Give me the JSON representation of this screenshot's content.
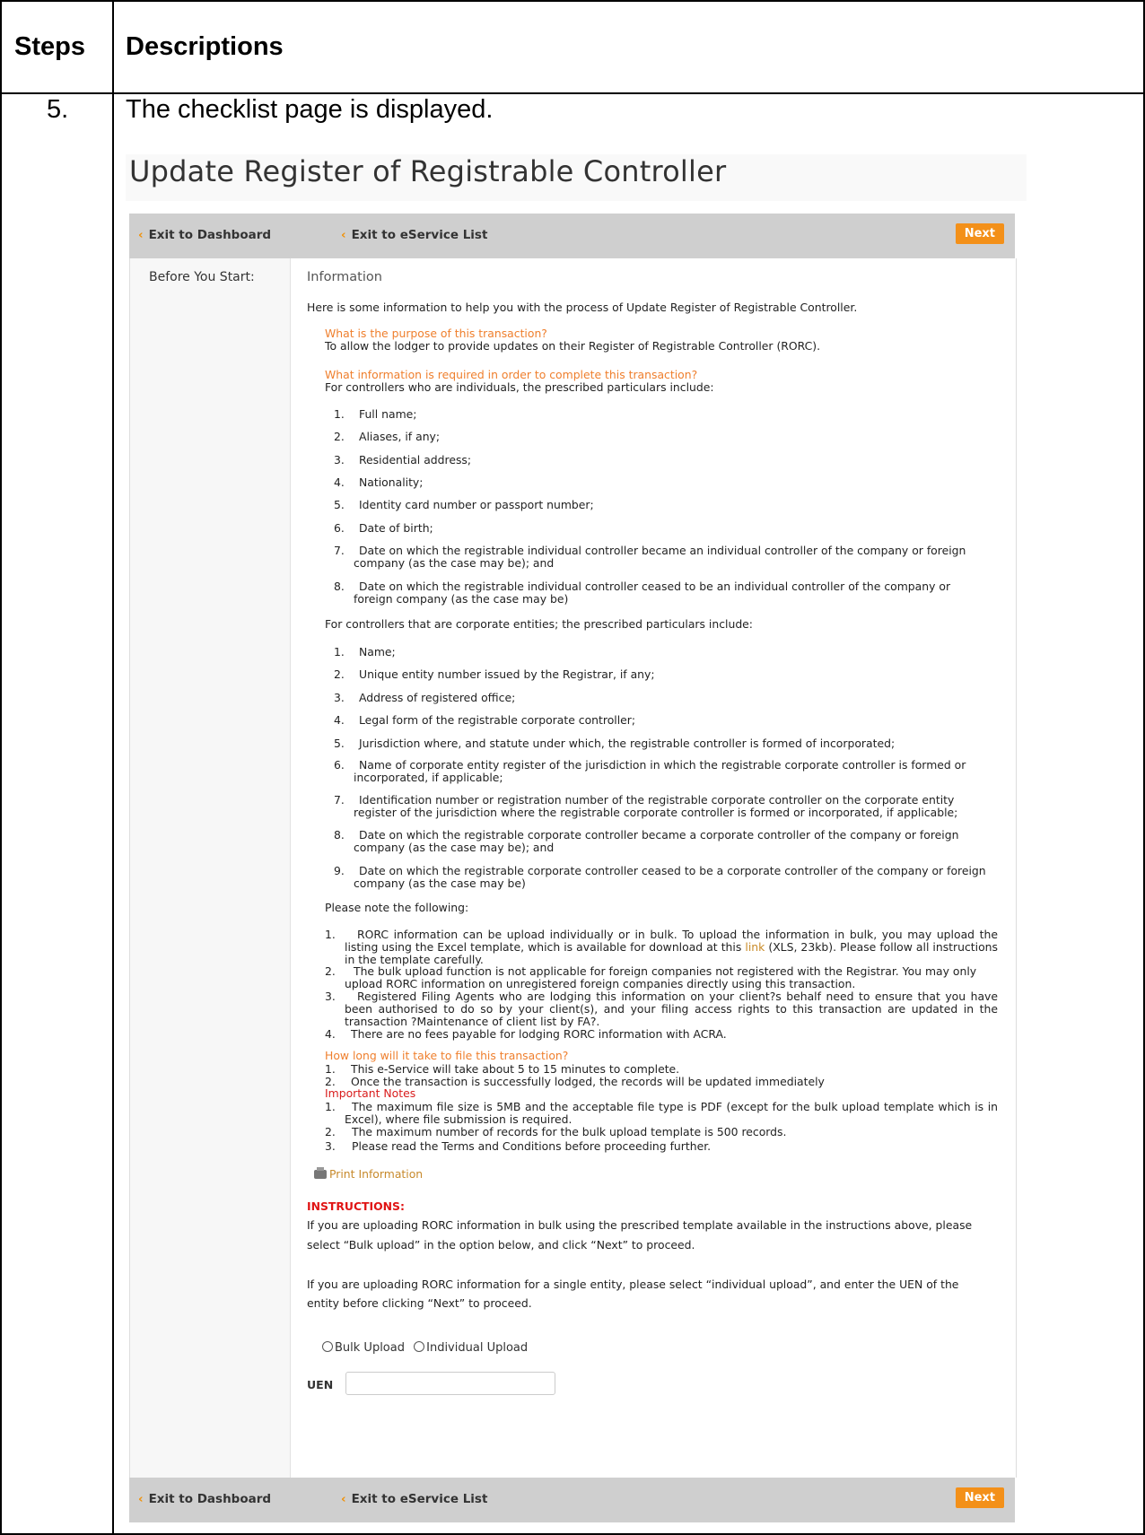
{
  "table": {
    "col_steps": "Steps",
    "col_descriptions": "Descriptions",
    "step_number": "5.",
    "step_text": "The checklist page is displayed."
  },
  "screen": {
    "title": "Update Register of Registrable Controller",
    "nav": {
      "exit_dashboard": "Exit to Dashboard",
      "exit_eservice": "Exit to eService List",
      "next": "Next"
    },
    "left_label": "Before You Start:",
    "info_heading": "Information",
    "intro": "Here is some information to help you with the process of Update Register of Registrable Controller.",
    "q1": "What is the purpose of this transaction?",
    "a1": "To allow the lodger to provide updates on their Register of Registrable Controller (RORC).",
    "q2": "What information is required in order to complete this transaction?",
    "individuals_intro": "For controllers who are individuals, the prescribed particulars include:",
    "individuals": [
      {
        "n": "1.",
        "t": "Full name;"
      },
      {
        "n": "2.",
        "t": "Aliases, if any;"
      },
      {
        "n": "3.",
        "t": "Residential address;"
      },
      {
        "n": "4.",
        "t": "Nationality;"
      },
      {
        "n": "5.",
        "t": "Identity card number or passport number;"
      },
      {
        "n": "6.",
        "t": "Date of birth;"
      },
      {
        "n": "7.",
        "t": "Date on which the registrable individual controller became an individual controller of the company or foreign",
        "t2": "company (as the case may be); and"
      },
      {
        "n": "8.",
        "t": "Date on which the registrable individual controller ceased to be an individual controller of the company or",
        "t2": "foreign company (as the case may be)"
      }
    ],
    "corporate_intro": "For controllers that are corporate entities; the prescribed particulars include:",
    "corporate": [
      {
        "n": "1.",
        "t": "Name;"
      },
      {
        "n": "2.",
        "t": "Unique entity number issued by the Registrar, if any;"
      },
      {
        "n": "3.",
        "t": "Address of registered office;"
      },
      {
        "n": "4.",
        "t": "Legal form of the registrable corporate controller;"
      },
      {
        "n": "5.",
        "t": "Jurisdiction where, and statute under which, the registrable controller is formed of incorporated;"
      },
      {
        "n": "6.",
        "t": "Name of corporate entity register of the jurisdiction in which the registrable corporate controller is formed or",
        "t2": "incorporated, if applicable;"
      },
      {
        "n": "7.",
        "t": "Identification number or registration number of the registrable corporate controller on the corporate entity",
        "t2": "register of the jurisdiction where the registrable corporate controller is formed or incorporated, if applicable;"
      },
      {
        "n": "8.",
        "t": "Date on which the registrable corporate controller became a corporate controller of the company or foreign",
        "t2": "company (as the case may be); and"
      },
      {
        "n": "9.",
        "t": "Date on which the registrable corporate controller ceased to be a corporate controller of the company or foreign",
        "t2": "company (as the case may be)"
      }
    ],
    "note_intro": "Please note the following:",
    "notes": {
      "n1_num": "1.",
      "n1_a": "RORC information can be upload individually or in bulk. To upload the information in bulk, you may upload the listing using the Excel template, which is available for download at this",
      "n1_link": "link",
      "n1_b": "(XLS, 23kb). Please follow all instructions in the template carefully.",
      "n2_num": "2.",
      "n2": "The bulk upload function is not applicable for foreign companies not registered with the Registrar. You may only upload RORC information on unregistered foreign companies directly using this transaction.",
      "n3_num": "3.",
      "n3": "Registered Filing Agents who are lodging this information on your client?s behalf need to ensure that you have been authorised to do so by your client(s), and your filing access rights to this transaction are updated in the transaction ?Maintenance of client list by FA?.",
      "n4_num": "4.",
      "n4": "There are no fees payable for lodging RORC information with ACRA."
    },
    "q3": "How long will it take to file this transaction?",
    "durations": [
      {
        "n": "1.",
        "t": "This e-Service will take about 5 to 15 minutes to complete."
      },
      {
        "n": "2.",
        "t": "Once the transaction is successfully lodged, the records will be updated immediately"
      }
    ],
    "important_heading": "Important Notes",
    "important": {
      "i1_num": "1.",
      "i1": "The maximum file size is 5MB and the acceptable file type is PDF (except for the bulk upload template which is in Excel), where file submission is required.",
      "i2_num": "2.",
      "i2": "The maximum number of records for the bulk upload template is 500 records.",
      "i3_num": "3.",
      "i3": "Please read the Terms and Conditions before proceeding further."
    },
    "print_info": "Print Information",
    "instructions_heading": "INSTRUCTIONS:",
    "instr1_line1": "If you are uploading RORC information in bulk using the prescribed template available in the instructions above, please",
    "instr1_line2": "select “Bulk upload” in the option below, and click “Next” to proceed.",
    "instr2_line1": "If you are uploading RORC information for a single entity, please select “individual upload”, and enter the UEN of the",
    "instr2_line2": "entity before clicking “Next” to proceed.",
    "radio_bulk": "Bulk Upload",
    "radio_individual": "Individual Upload",
    "uen_label": "UEN",
    "uen_value": ""
  },
  "icons": {
    "chevron": "chevron-left-icon",
    "printer": "printer-icon"
  },
  "colors": {
    "accent_orange": "#f39019",
    "question_orange": "#ef7f2d",
    "important_red": "#d91c1c",
    "nav_gray": "#cfcfcf"
  }
}
